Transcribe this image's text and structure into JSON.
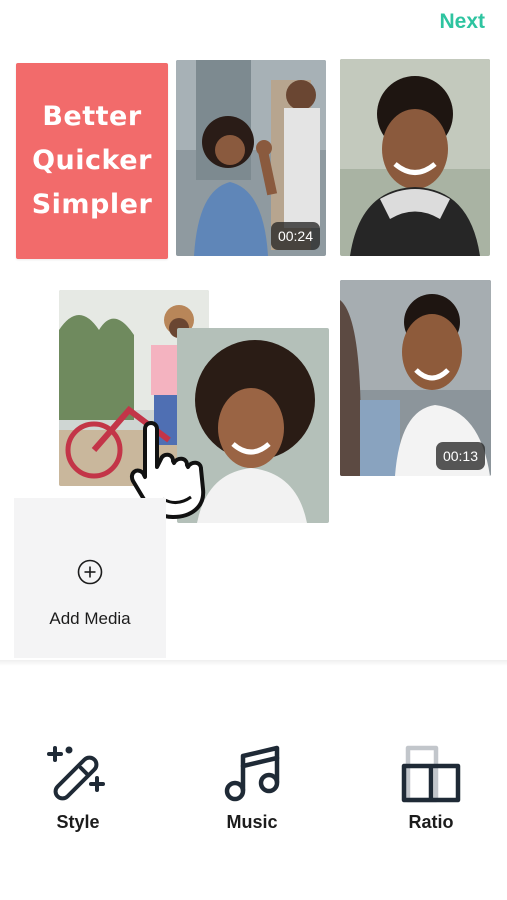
{
  "header": {
    "next_label": "Next"
  },
  "promo": {
    "lines": [
      "Better",
      "Quicker",
      "Simpler"
    ]
  },
  "media": [
    {
      "name": "photo-woman-waving",
      "duration": "00:24"
    },
    {
      "name": "photo-man-smiling-hoodie",
      "duration": null
    },
    {
      "name": "photo-woman-bike-phone",
      "duration": null
    },
    {
      "name": "photo-woman-curly-smiling",
      "duration": null
    },
    {
      "name": "photo-man-laughing",
      "duration": "00:13"
    }
  ],
  "add_media": {
    "label": "Add Media",
    "icon": "plus-circle-icon"
  },
  "toolbar": {
    "style_label": "Style",
    "music_label": "Music",
    "ratio_label": "Ratio",
    "icons": [
      "magic-wand-icon",
      "music-note-icon",
      "ratio-icon"
    ]
  },
  "colors": {
    "accent": "#2ec4a0",
    "promo": "#f26b6b",
    "icon": "#1f2a36"
  }
}
